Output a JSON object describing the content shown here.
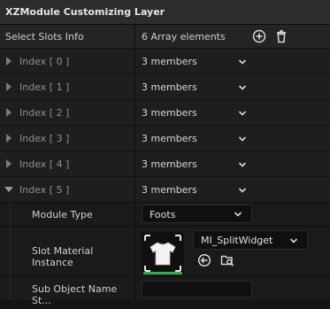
{
  "header": {
    "title": "XZModule Customizing Layer"
  },
  "select_slots": {
    "label": "Select Slots Info",
    "value": "6 Array elements"
  },
  "indices": [
    {
      "label": "Index [ 0 ]",
      "value": "3 members",
      "expanded": false
    },
    {
      "label": "Index [ 1 ]",
      "value": "3 members",
      "expanded": false
    },
    {
      "label": "Index [ 2 ]",
      "value": "3 members",
      "expanded": false
    },
    {
      "label": "Index [ 3 ]",
      "value": "3 members",
      "expanded": false
    },
    {
      "label": "Index [ 4 ]",
      "value": "3 members",
      "expanded": false
    },
    {
      "label": "Index [ 5 ]",
      "value": "3 members",
      "expanded": true
    }
  ],
  "module_type": {
    "label": "Module Type",
    "value": "Foots"
  },
  "slot_material": {
    "label": "Slot Material Instance",
    "value": "MI_SplitWidget"
  },
  "sub_object": {
    "label": "Sub Object Name St...",
    "value": ""
  }
}
